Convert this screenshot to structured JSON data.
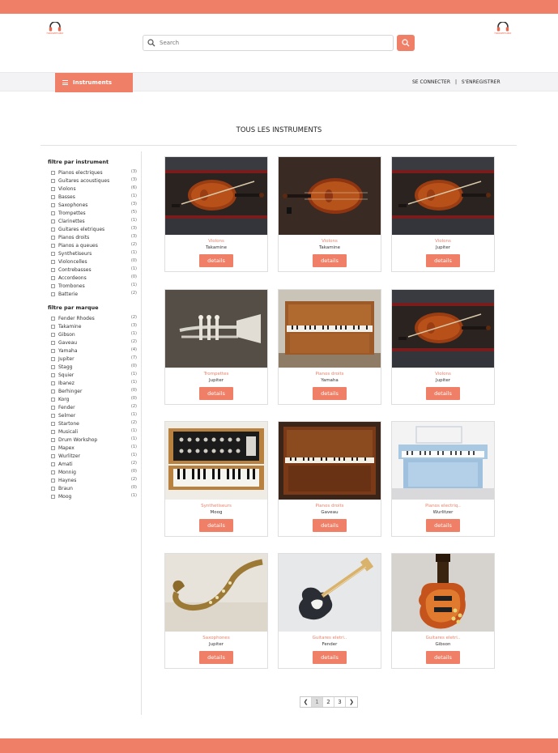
{
  "brand": {
    "logo_text": "housemusic",
    "accent": "#ef7f66"
  },
  "search": {
    "placeholder": "Search",
    "icon": "search-icon"
  },
  "nav": {
    "menu_label": "Instruments",
    "login": "SE CONNECTER",
    "separator": "|",
    "register": "S'ENREGISTRER"
  },
  "page": {
    "title": "TOUS LES INSTRUMENTS"
  },
  "filters": {
    "instrument_title": "filtre par instrument",
    "instrument": [
      {
        "label": "Pianos electriques",
        "count": "(3)"
      },
      {
        "label": "Guitares acoustiques",
        "count": "(3)"
      },
      {
        "label": "Violons",
        "count": "(6)"
      },
      {
        "label": "Basses",
        "count": "(1)"
      },
      {
        "label": "Saxophones",
        "count": "(3)"
      },
      {
        "label": "Trompettes",
        "count": "(5)"
      },
      {
        "label": "Clarinettes",
        "count": "(1)"
      },
      {
        "label": "Guitares eletriques",
        "count": "(3)"
      },
      {
        "label": "Pianos droits",
        "count": "(3)"
      },
      {
        "label": "Pianos a queues",
        "count": "(2)"
      },
      {
        "label": "Synthetiseurs",
        "count": "(1)"
      },
      {
        "label": "Violoncelles",
        "count": "(0)"
      },
      {
        "label": "Contrebasses",
        "count": "(1)"
      },
      {
        "label": "Accordeons",
        "count": "(0)"
      },
      {
        "label": "Trombones",
        "count": "(1)"
      },
      {
        "label": "Batterie",
        "count": "(2)"
      }
    ],
    "brand_title": "filtre par marque",
    "brand": [
      {
        "label": "Fender Rhodes",
        "count": "(2)"
      },
      {
        "label": "Takamine",
        "count": "(3)"
      },
      {
        "label": "Gibson",
        "count": "(1)"
      },
      {
        "label": "Gaveau",
        "count": "(2)"
      },
      {
        "label": "Yamaha",
        "count": "(4)"
      },
      {
        "label": "Jupiter",
        "count": "(7)"
      },
      {
        "label": "Stagg",
        "count": "(0)"
      },
      {
        "label": "Squier",
        "count": "(1)"
      },
      {
        "label": "Ibanez",
        "count": "(1)"
      },
      {
        "label": "Berhinger",
        "count": "(0)"
      },
      {
        "label": "Korg",
        "count": "(0)"
      },
      {
        "label": "Fender",
        "count": "(2)"
      },
      {
        "label": "Selmer",
        "count": "(1)"
      },
      {
        "label": "Startone",
        "count": "(2)"
      },
      {
        "label": "Musicali",
        "count": "(1)"
      },
      {
        "label": "Drum Workshop",
        "count": "(1)"
      },
      {
        "label": "Mapex",
        "count": "(1)"
      },
      {
        "label": "Wurlitzer",
        "count": "(1)"
      },
      {
        "label": "Amati",
        "count": "(2)"
      },
      {
        "label": "Monnig",
        "count": "(0)"
      },
      {
        "label": "Haynes",
        "count": "(2)"
      },
      {
        "label": "Braun",
        "count": "(0)"
      },
      {
        "label": "Moog",
        "count": "(1)"
      }
    ]
  },
  "products": [
    {
      "category": "Violons",
      "brand": "Takamine",
      "details": "details",
      "image": "violin"
    },
    {
      "category": "Violons",
      "brand": "Takamine",
      "details": "details",
      "image": "violin-plain"
    },
    {
      "category": "Violons",
      "brand": "Jupiter",
      "details": "details",
      "image": "violin"
    },
    {
      "category": "Trompettes",
      "brand": "Jupiter",
      "details": "details",
      "image": "trumpet"
    },
    {
      "category": "Pianos droits",
      "brand": "Yamaha",
      "details": "details",
      "image": "upright-piano"
    },
    {
      "category": "Violons",
      "brand": "Jupiter",
      "details": "details",
      "image": "violin"
    },
    {
      "category": "Synthetiseurs",
      "brand": "Moog",
      "details": "details",
      "image": "synth"
    },
    {
      "category": "Pianos droits",
      "brand": "Gaveau",
      "details": "details",
      "image": "upright-piano-dark"
    },
    {
      "category": "Pianos electriq..",
      "brand": "Wurlitzer",
      "details": "details",
      "image": "electric-piano"
    },
    {
      "category": "Saxophones",
      "brand": "Jupiter",
      "details": "details",
      "image": "saxophone"
    },
    {
      "category": "Guitares eletri..",
      "brand": "Fender",
      "details": "details",
      "image": "strat"
    },
    {
      "category": "Guitares eletri..",
      "brand": "Gibson",
      "details": "details",
      "image": "les-paul"
    }
  ],
  "pagination": {
    "prev": "❮",
    "pages": [
      "1",
      "2",
      "3"
    ],
    "next": "❯",
    "current": "1"
  }
}
